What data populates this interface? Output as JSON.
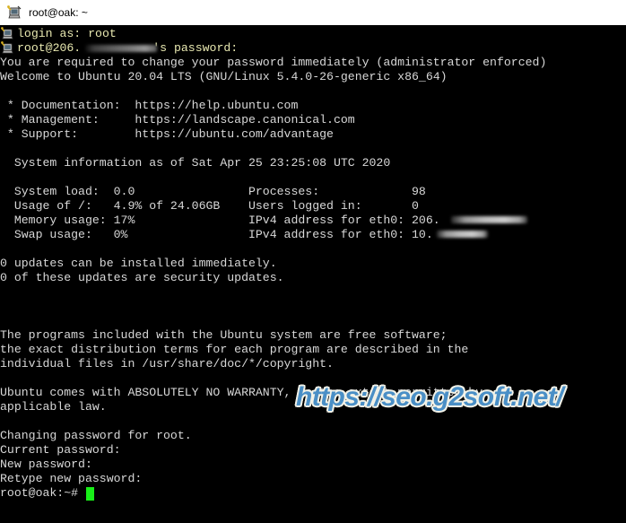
{
  "window": {
    "title": "root@oak: ~",
    "icon": "putty-icon",
    "background_color": "#000000",
    "titlebar_color": "#ffffff",
    "foreground_color": "#d8d8d8",
    "prompt_color": "#e8e8b0",
    "cursor_color": "#18ef18"
  },
  "terminal": {
    "lines": [
      {
        "text": "login as: root",
        "color": "yellow"
      },
      {
        "text": "root@206.",
        "suffix": "'s password:",
        "color": "yellow",
        "redacted": true
      },
      {
        "text": "You are required to change your password immediately (administrator enforced)",
        "color": "white"
      },
      {
        "text": "Welcome to Ubuntu 20.04 LTS (GNU/Linux 5.4.0-26-generic x86_64)",
        "color": "white"
      },
      {
        "text": "",
        "color": "white"
      },
      {
        "text": " * Documentation:  https://help.ubuntu.com",
        "color": "white"
      },
      {
        "text": " * Management:     https://landscape.canonical.com",
        "color": "white"
      },
      {
        "text": " * Support:        https://ubuntu.com/advantage",
        "color": "white"
      },
      {
        "text": "",
        "color": "white"
      },
      {
        "text": "  System information as of Sat Apr 25 23:25:08 UTC 2020",
        "color": "white"
      },
      {
        "text": "",
        "color": "white"
      },
      {
        "text": "  System load:  0.0                Processes:             98",
        "color": "white"
      },
      {
        "text": "  Usage of /:   4.9% of 24.06GB    Users logged in:       0",
        "color": "white"
      },
      {
        "text": "  Memory usage: 17%                IPv4 address for eth0: 206.",
        "color": "white",
        "redacted": true
      },
      {
        "text": "  Swap usage:   0%                 IPv4 address for eth0: 10.",
        "color": "white",
        "redacted": true
      },
      {
        "text": "",
        "color": "white"
      },
      {
        "text": "0 updates can be installed immediately.",
        "color": "white"
      },
      {
        "text": "0 of these updates are security updates.",
        "color": "white"
      },
      {
        "text": "",
        "color": "white"
      },
      {
        "text": "",
        "color": "white"
      },
      {
        "text": "",
        "color": "white"
      },
      {
        "text": "The programs included with the Ubuntu system are free software;",
        "color": "white"
      },
      {
        "text": "the exact distribution terms for each program are described in the",
        "color": "white"
      },
      {
        "text": "individual files in /usr/share/doc/*/copyright.",
        "color": "white"
      },
      {
        "text": "",
        "color": "white"
      },
      {
        "text": "Ubuntu comes with ABSOLUTELY NO WARRANTY, to the extent permitted by",
        "color": "white"
      },
      {
        "text": "applicable law.",
        "color": "white"
      },
      {
        "text": "",
        "color": "white"
      },
      {
        "text": "Changing password for root.",
        "color": "white"
      },
      {
        "text": "Current password:",
        "color": "white"
      },
      {
        "text": "New password:",
        "color": "white"
      },
      {
        "text": "Retype new password:",
        "color": "white"
      },
      {
        "text": "root@oak:~# ",
        "color": "white"
      }
    ],
    "line_0": "login as: root",
    "line_1_prefix": "root@206.",
    "line_1_suffix": "'s password:",
    "line_2": "You are required to change your password immediately (administrator enforced)",
    "line_3": "Welcome to Ubuntu 20.04 LTS (GNU/Linux 5.4.0-26-generic x86_64)",
    "line_5": " * Documentation:  https://help.ubuntu.com",
    "line_6": " * Management:     https://landscape.canonical.com",
    "line_7": " * Support:        https://ubuntu.com/advantage",
    "line_9": "  System information as of Sat Apr 25 23:25:08 UTC 2020",
    "line_11": "  System load:  0.0                Processes:             98",
    "line_12": "  Usage of /:   4.9% of 24.06GB    Users logged in:       0",
    "line_13": "  Memory usage: 17%                IPv4 address for eth0: 206.",
    "line_14": "  Swap usage:   0%                 IPv4 address for eth0: 10.",
    "line_16": "0 updates can be installed immediately.",
    "line_17": "0 of these updates are security updates.",
    "line_21": "The programs included with the Ubuntu system are free software;",
    "line_22": "the exact distribution terms for each program are described in the",
    "line_23": "individual files in /usr/share/doc/*/copyright.",
    "line_25": "Ubuntu comes with ABSOLUTELY NO WARRANTY, to the extent permitted by",
    "line_26": "applicable law.",
    "line_28": "Changing password for root.",
    "line_29": "Current password:",
    "line_30": "New password:",
    "line_31": "Retype new password:",
    "line_32": "root@oak:~# "
  },
  "system_info": {
    "header": "System information as of Sat Apr 25 23:25:08 UTC 2020",
    "date": "Sat Apr 25 23:25:08 UTC 2020",
    "rows": [
      {
        "label": "System load:",
        "value": "0.0",
        "label2": "Processes:",
        "value2": "98"
      },
      {
        "label": "Usage of /:",
        "value": "4.9% of 24.06GB",
        "label2": "Users logged in:",
        "value2": "0"
      },
      {
        "label": "Memory usage:",
        "value": "17%",
        "label2": "IPv4 address for eth0:",
        "value2": "206."
      },
      {
        "label": "Swap usage:",
        "value": "0%",
        "label2": "IPv4 address for eth0:",
        "value2": "10."
      }
    ],
    "links": [
      {
        "label": " * Documentation:",
        "url": "https://help.ubuntu.com"
      },
      {
        "label": " * Management:",
        "url": "https://landscape.canonical.com"
      },
      {
        "label": " * Support:",
        "url": "https://ubuntu.com/advantage"
      }
    ],
    "updates_available": "0 updates can be installed immediately.",
    "updates_security": "0 of these updates are security updates."
  },
  "watermark": {
    "text": "https://seo.g2soft.net/",
    "color": "#4a8fc6",
    "outline_color": "#f2f2e8"
  }
}
